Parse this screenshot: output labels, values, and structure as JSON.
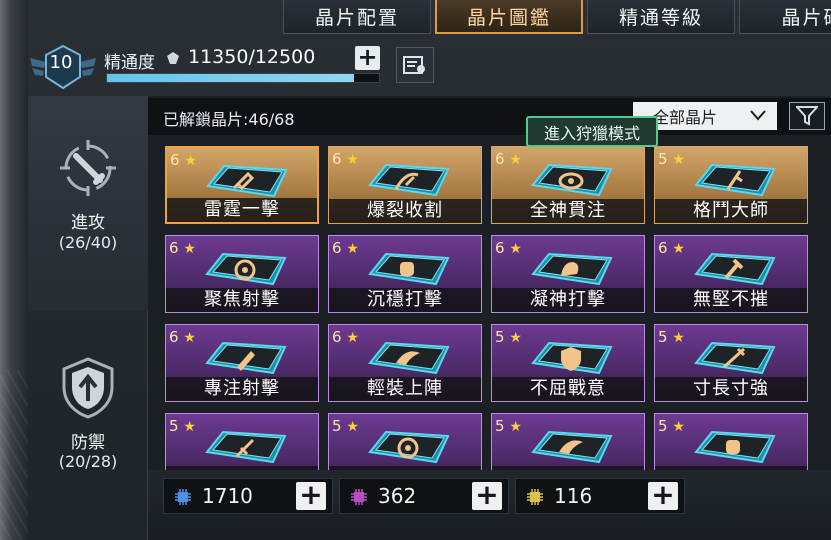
{
  "tabs": [
    {
      "label": "晶片配置",
      "active": false
    },
    {
      "label": "晶片圖鑑",
      "active": true
    },
    {
      "label": "精通等級",
      "active": false
    },
    {
      "label": "晶片碎",
      "active": false
    }
  ],
  "header": {
    "level": "10",
    "mastery_label": "精通度",
    "mastery_value": "11350/12500",
    "mastery_progress": 0.908,
    "plus_label": "+"
  },
  "sidebar": {
    "attack": {
      "label": "進攻",
      "count": "(26/40)"
    },
    "defense": {
      "label": "防禦",
      "count": "(20/28)"
    }
  },
  "unlock_text": "已解鎖晶片:46/68",
  "filter": {
    "selected": "全部晶片"
  },
  "tooltip": "進入狩獵模式",
  "cards": [
    {
      "stars": "6",
      "name": "雷霆一擊",
      "tier": "gold",
      "selected": true,
      "glyph": "rocket"
    },
    {
      "stars": "6",
      "name": "爆裂收割",
      "tier": "gold",
      "selected": false,
      "glyph": "scythe"
    },
    {
      "stars": "6",
      "name": "全神貫注",
      "tier": "gold",
      "selected": false,
      "glyph": "eye"
    },
    {
      "stars": "5",
      "name": "格鬥大師",
      "tier": "gold",
      "selected": false,
      "glyph": "knife"
    },
    {
      "stars": "6",
      "name": "聚焦射擊",
      "tier": "purple",
      "selected": false,
      "glyph": "target"
    },
    {
      "stars": "6",
      "name": "沉穩打擊",
      "tier": "purple",
      "selected": false,
      "glyph": "fist"
    },
    {
      "stars": "6",
      "name": "凝神打擊",
      "tier": "purple",
      "selected": false,
      "glyph": "arm"
    },
    {
      "stars": "6",
      "name": "無堅不摧",
      "tier": "purple",
      "selected": false,
      "glyph": "hammer"
    },
    {
      "stars": "6",
      "name": "專注射擊",
      "tier": "purple",
      "selected": false,
      "glyph": "bullet"
    },
    {
      "stars": "6",
      "name": "輕裝上陣",
      "tier": "purple",
      "selected": false,
      "glyph": "wing"
    },
    {
      "stars": "5",
      "name": "不屈戰意",
      "tier": "purple",
      "selected": false,
      "glyph": "shield"
    },
    {
      "stars": "5",
      "name": "寸長寸強",
      "tier": "purple",
      "selected": false,
      "glyph": "blade"
    },
    {
      "stars": "5",
      "name": "",
      "tier": "purple",
      "selected": false,
      "glyph": "dagger"
    },
    {
      "stars": "5",
      "name": "",
      "tier": "purple",
      "selected": false,
      "glyph": "target"
    },
    {
      "stars": "5",
      "name": "",
      "tier": "purple",
      "selected": false,
      "glyph": "wing"
    },
    {
      "stars": "5",
      "name": "",
      "tier": "purple",
      "selected": false,
      "glyph": "fist"
    }
  ],
  "currencies": [
    {
      "amount": "1710",
      "color": "#4f8fe0"
    },
    {
      "amount": "362",
      "color": "#b84fc4"
    },
    {
      "amount": "116",
      "color": "#d8c24a"
    }
  ],
  "colors": {
    "accent": "#e39a3c",
    "xp": "#63c4ec",
    "tooltip_border": "#53c98a"
  }
}
